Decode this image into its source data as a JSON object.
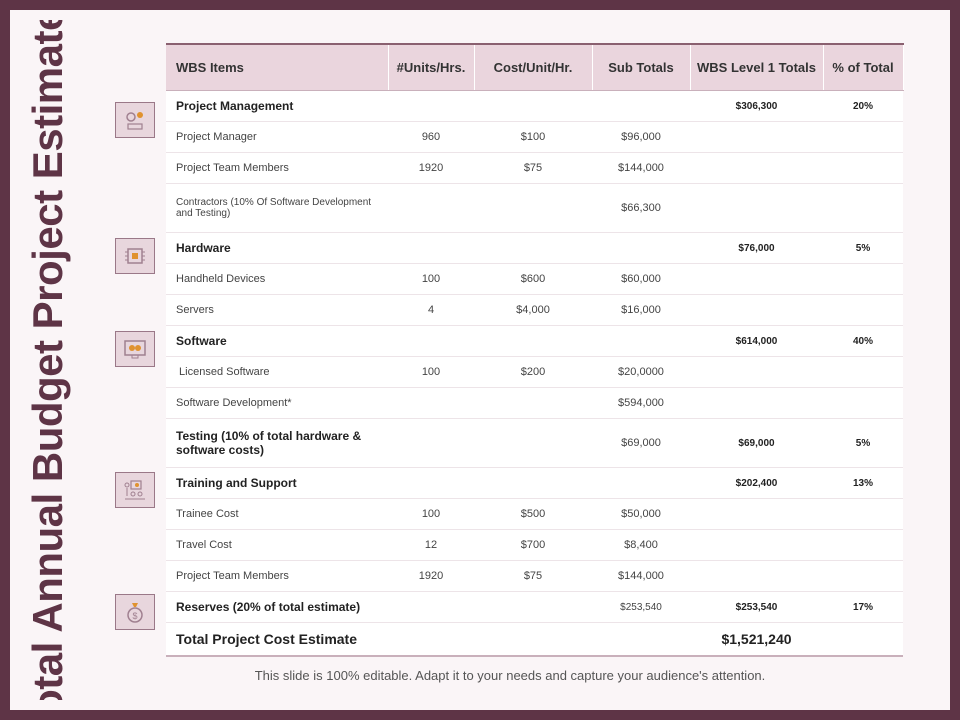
{
  "title": "Total Annual Budget Project Estimated",
  "footer": "This slide is 100% editable. Adapt it to your needs and capture your audience's attention.",
  "headers": [
    "WBS Items",
    "#Units/Hrs.",
    "Cost/Unit/Hr.",
    "Sub Totals",
    "WBS Level 1 Totals",
    "% of Total"
  ],
  "rows": [
    {
      "item": "Project Management",
      "units": "",
      "cost": "",
      "sub": "",
      "level1": "$306,300",
      "pct": "20%"
    },
    {
      "item": "Project Manager",
      "units": "960",
      "cost": "$100",
      "sub": "$96,000",
      "level1": "",
      "pct": ""
    },
    {
      "item": "Project Team Members",
      "units": "1920",
      "cost": "$75",
      "sub": "$144,000",
      "level1": "",
      "pct": ""
    },
    {
      "item": "Contractors (10% Of Software Development and Testing)",
      "units": "",
      "cost": "",
      "sub": "$66,300",
      "level1": "",
      "pct": ""
    },
    {
      "item": "Hardware",
      "units": "",
      "cost": "",
      "sub": "",
      "level1": "$76,000",
      "pct": "5%"
    },
    {
      "item": "Handheld Devices",
      "units": "100",
      "cost": "$600",
      "sub": "$60,000",
      "level1": "",
      "pct": ""
    },
    {
      "item": "Servers",
      "units": "4",
      "cost": "$4,000",
      "sub": "$16,000",
      "level1": "",
      "pct": ""
    },
    {
      "item": "Software",
      "units": "",
      "cost": "",
      "sub": "",
      "level1": "$614,000",
      "pct": "40%"
    },
    {
      "item": " Licensed Software",
      "units": "100",
      "cost": "$200",
      "sub": "$20,0000",
      "level1": "",
      "pct": ""
    },
    {
      "item": "Software Development*",
      "units": "",
      "cost": "",
      "sub": "$594,000",
      "level1": "",
      "pct": ""
    },
    {
      "item": "Testing (10% of total hardware & software costs)",
      "units": "",
      "cost": "",
      "sub": "$69,000",
      "level1": "$69,000",
      "pct": "5%"
    },
    {
      "item": "Training and Support",
      "units": "",
      "cost": "",
      "sub": "",
      "level1": "$202,400",
      "pct": "13%"
    },
    {
      "item": "Trainee Cost",
      "units": "100",
      "cost": "$500",
      "sub": "$50,000",
      "level1": "",
      "pct": ""
    },
    {
      "item": "Travel Cost",
      "units": "12",
      "cost": "$700",
      "sub": "$8,400",
      "level1": "",
      "pct": ""
    },
    {
      "item": "Project Team Members",
      "units": "1920",
      "cost": "$75",
      "sub": "$144,000",
      "level1": "",
      "pct": ""
    },
    {
      "item": "Reserves (20% of total estimate)",
      "units": "",
      "cost": "",
      "sub": "$253,540",
      "level1": "$253,540",
      "pct": "17%"
    }
  ],
  "total": {
    "label": "Total Project Cost Estimate",
    "value": "$1,521,240"
  },
  "icons": [
    "gears-people-icon",
    "chip-icon",
    "monitor-gears-icon",
    "presentation-people-icon",
    "money-bag-icon"
  ],
  "colors": {
    "frame": "#5e3446",
    "header_bg": "#ead5dd",
    "icon_bg": "#e8d6dd",
    "accent_icon": "#e0922f"
  }
}
